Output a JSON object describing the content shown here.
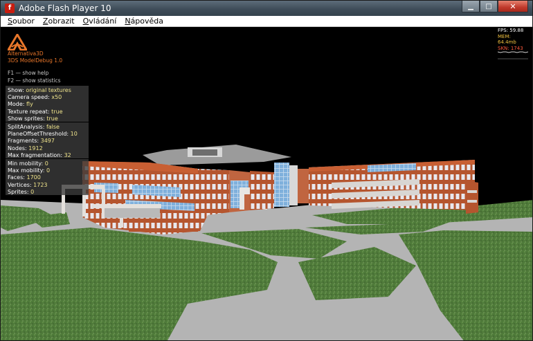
{
  "window": {
    "title": "Adobe Flash Player 10",
    "icon": "flash-icon",
    "min_icon": "minimize-icon",
    "max_icon": "maximize-icon",
    "close_icon": "close-icon"
  },
  "menu": [
    "Soubor",
    "Zobrazit",
    "Ovládání",
    "Nápověda"
  ],
  "brand": {
    "name": "Alternativa3D",
    "version": "3DS ModelDebug 1.0",
    "logo_color": "#e8762a"
  },
  "help": [
    "F1 — show help",
    "F2 — show statistics"
  ],
  "panel1": [
    {
      "label": "Show: ",
      "value": "original textures"
    },
    {
      "label": "Camera speed: ",
      "value": "x50"
    },
    {
      "label": "Mode: ",
      "value": "fly"
    },
    {
      "label": "Texture repeat: ",
      "value": "true"
    },
    {
      "label": "Show sprites: ",
      "value": "true"
    }
  ],
  "panel2": [
    {
      "label": "SplitAnalysis: ",
      "value": "false"
    },
    {
      "label": "PlaneOffsetThreshold: ",
      "value": "10"
    },
    {
      "label": "Fragments: ",
      "value": "3497"
    },
    {
      "label": "Nodes: ",
      "value": "1912"
    },
    {
      "label": "Max fragmentation: ",
      "value": "32"
    }
  ],
  "panel3": [
    {
      "label": "Min mobility: ",
      "value": "0"
    },
    {
      "label": "Max mobility: ",
      "value": "0"
    },
    {
      "label": "Faces: ",
      "value": "1700"
    },
    {
      "label": "Vertices: ",
      "value": "1723"
    },
    {
      "label": "Sprites: ",
      "value": "0"
    }
  ],
  "stats": {
    "fps": "FPS: 59.88",
    "mem": "MEM: 64.4mb",
    "skn": "SKN: 1743"
  },
  "colors": {
    "grass": "#4f7a3a",
    "pavement": "#b4b4b4",
    "brick": "#b5552e",
    "glass": "#7fb0dc",
    "roof": "#9b9b9b",
    "value_text": "#f0e48c"
  }
}
